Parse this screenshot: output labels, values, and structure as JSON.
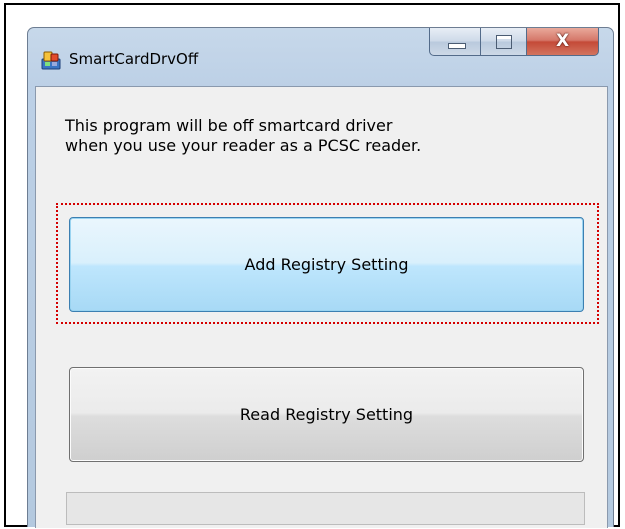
{
  "window": {
    "title": "SmartCardDrvOff",
    "minimize_label": "",
    "maximize_label": "",
    "close_label": "X"
  },
  "main": {
    "description_line1": "This program will be off smartcard driver",
    "description_line2": "when you use your reader as a PCSC reader.",
    "add_button_label": "Add Registry Setting",
    "read_button_label": "Read Registry Setting",
    "progress_value": 0
  },
  "icons": {
    "app": "app-icon",
    "minimize": "minimize-icon",
    "maximize": "maximize-icon",
    "close": "close-icon"
  },
  "colors": {
    "focus_ring": "#d40000",
    "selected_button": "#bee6fd",
    "close_button": "#c44a38"
  }
}
